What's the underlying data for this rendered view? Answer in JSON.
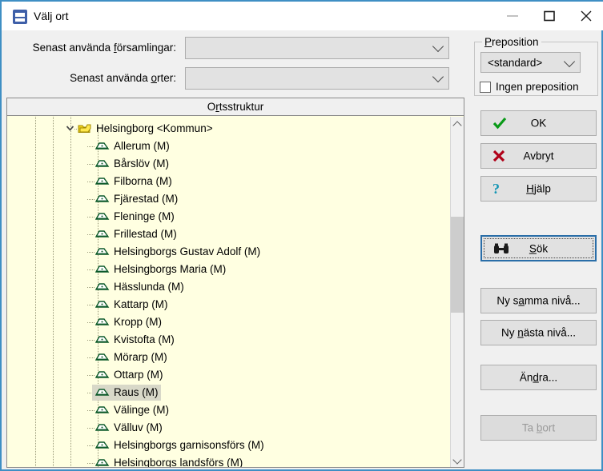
{
  "window": {
    "title": "Välj ort",
    "app_icon": "app-icon",
    "controls": {
      "minimize": "minimize-icon",
      "maximize": "maximize-icon",
      "close": "close-icon"
    },
    "accent_color": "#3f8fc4",
    "background_color": "#f0f0f0"
  },
  "form": {
    "forsamlingar": {
      "label_before": "Senast använda ",
      "label_accel": "f",
      "label_after": "örsamlingar:",
      "value": "",
      "placeholder": ""
    },
    "orter": {
      "label_before": "Senast använda ",
      "label_accel": "o",
      "label_after": "rter:",
      "value": "",
      "placeholder": ""
    }
  },
  "tree": {
    "header_before": "O",
    "header_accel": "r",
    "header_after": "tsstruktur",
    "background_color": "#ffffe1",
    "selection_color": "#d8d8c8",
    "rows": [
      {
        "label": "Helsingborg <Kommun>",
        "level": 0,
        "icon": "folder-kommun-icon",
        "expanded": true,
        "selected": false
      },
      {
        "label": "Allerum (M)",
        "level": 1,
        "icon": "place-icon",
        "selected": false
      },
      {
        "label": "Bårslöv (M)",
        "level": 1,
        "icon": "place-icon",
        "selected": false
      },
      {
        "label": "Filborna (M)",
        "level": 1,
        "icon": "place-icon",
        "selected": false
      },
      {
        "label": "Fjärestad (M)",
        "level": 1,
        "icon": "place-icon",
        "selected": false
      },
      {
        "label": "Fleninge (M)",
        "level": 1,
        "icon": "place-icon",
        "selected": false
      },
      {
        "label": "Frillestad (M)",
        "level": 1,
        "icon": "place-icon",
        "selected": false
      },
      {
        "label": "Helsingborgs Gustav Adolf (M)",
        "level": 1,
        "icon": "place-icon",
        "selected": false
      },
      {
        "label": "Helsingborgs Maria (M)",
        "level": 1,
        "icon": "place-icon",
        "selected": false
      },
      {
        "label": "Hässlunda (M)",
        "level": 1,
        "icon": "place-icon",
        "selected": false
      },
      {
        "label": "Kattarp (M)",
        "level": 1,
        "icon": "place-icon",
        "selected": false
      },
      {
        "label": "Kropp (M)",
        "level": 1,
        "icon": "place-icon",
        "selected": false
      },
      {
        "label": "Kvistofta (M)",
        "level": 1,
        "icon": "place-icon",
        "selected": false
      },
      {
        "label": "Mörarp (M)",
        "level": 1,
        "icon": "place-icon",
        "selected": false
      },
      {
        "label": "Ottarp (M)",
        "level": 1,
        "icon": "place-icon",
        "selected": false
      },
      {
        "label": "Raus (M)",
        "level": 1,
        "icon": "place-icon",
        "selected": true
      },
      {
        "label": "Välinge (M)",
        "level": 1,
        "icon": "place-icon",
        "selected": false
      },
      {
        "label": "Välluv (M)",
        "level": 1,
        "icon": "place-icon",
        "selected": false
      },
      {
        "label": "Helsingborgs garnisonsförs (M)",
        "level": 1,
        "icon": "place-icon",
        "selected": false
      },
      {
        "label": "Helsingborgs landsförs (M)",
        "level": 1,
        "icon": "place-icon",
        "selected": false
      }
    ],
    "scrollbar": {
      "up": "scroll-up-arrow-icon",
      "down": "scroll-down-arrow-icon"
    }
  },
  "preposition": {
    "group_before": "P",
    "group_accel": "",
    "group_title": "Preposition",
    "selected_option": "<standard>",
    "options": [
      "<standard>"
    ],
    "checkbox_label": "Ingen preposition",
    "checkbox_checked": false
  },
  "buttons": {
    "ok": {
      "label": "OK",
      "icon": "green-check-icon",
      "enabled": true
    },
    "avbryt": {
      "label": "Avbryt",
      "icon": "red-x-icon",
      "enabled": true
    },
    "hjalp": {
      "label": "Hjälp",
      "icon": "question-mark-icon",
      "enabled": true,
      "accel": "H"
    },
    "sok": {
      "label": "Sök",
      "icon": "binoculars-icon",
      "enabled": true,
      "focused": true,
      "accel": "S"
    },
    "ny_samma_niva": {
      "label": "Ny samma nivå...",
      "enabled": true
    },
    "ny_nasta_niva": {
      "label": "Ny nästa nivå...",
      "enabled": true
    },
    "andra": {
      "label": "Ändra...",
      "enabled": true
    },
    "ta_bort": {
      "label": "Ta bort",
      "enabled": false
    }
  }
}
